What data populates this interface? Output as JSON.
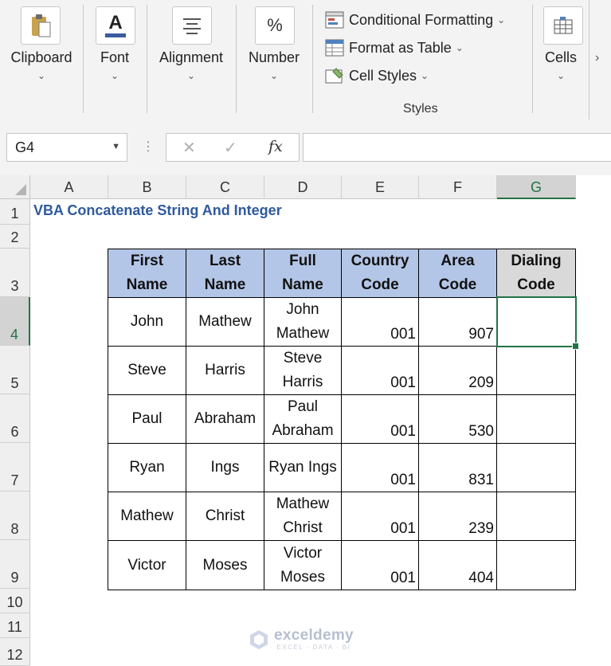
{
  "ribbon": {
    "clipboard": "Clipboard",
    "font": "Font",
    "alignment": "Alignment",
    "number": "Number",
    "number_icon": "%",
    "font_icon": "A",
    "conditional_formatting": "Conditional Formatting",
    "format_as_table": "Format as Table",
    "cell_styles": "Cell Styles",
    "styles_group": "Styles",
    "cells": "Cells",
    "chevron": "⌄",
    "scroll_arrow": "›"
  },
  "formula_bar": {
    "name_box": "G4",
    "name_box_arrow": "▼",
    "dots": "⋮",
    "cancel": "✕",
    "enter": "✓",
    "fx": "fx",
    "formula": ""
  },
  "grid": {
    "columns": [
      "A",
      "B",
      "C",
      "D",
      "E",
      "F",
      "G"
    ],
    "rows": [
      "1",
      "2",
      "3",
      "4",
      "5",
      "6",
      "7",
      "8",
      "9",
      "10",
      "11",
      "12"
    ],
    "active_cell": "G4",
    "title": "VBA Concatenate String And Integer",
    "table": {
      "headers": [
        [
          "First",
          "Name"
        ],
        [
          "Last",
          "Name"
        ],
        [
          "Full",
          "Name"
        ],
        [
          "Country",
          "Code"
        ],
        [
          "Area",
          "Code"
        ],
        [
          "Dialing",
          "Code"
        ]
      ],
      "rows": [
        {
          "first": "John",
          "last": "Mathew",
          "full": [
            "John",
            "Mathew"
          ],
          "country": "001",
          "area": "907",
          "dialing": ""
        },
        {
          "first": "Steve",
          "last": "Harris",
          "full": [
            "Steve",
            "Harris"
          ],
          "country": "001",
          "area": "209",
          "dialing": ""
        },
        {
          "first": "Paul",
          "last": "Abraham",
          "full": [
            "Paul",
            "Abraham"
          ],
          "country": "001",
          "area": "530",
          "dialing": ""
        },
        {
          "first": "Ryan",
          "last": "Ings",
          "full": [
            "Ryan Ings"
          ],
          "country": "001",
          "area": "831",
          "dialing": ""
        },
        {
          "first": "Mathew",
          "last": "Christ",
          "full": [
            "Mathew",
            "Christ"
          ],
          "country": "001",
          "area": "239",
          "dialing": ""
        },
        {
          "first": "Victor",
          "last": "Moses",
          "full": [
            "Victor",
            "Moses"
          ],
          "country": "001",
          "area": "404",
          "dialing": ""
        }
      ]
    }
  },
  "watermark": {
    "name": "exceldemy",
    "tagline": "EXCEL · DATA · BI"
  },
  "colors": {
    "header_blue": "#b4c6e7",
    "header_gray": "#d9d9d9",
    "title_blue": "#2f5a9e",
    "selection_green": "#217346"
  }
}
